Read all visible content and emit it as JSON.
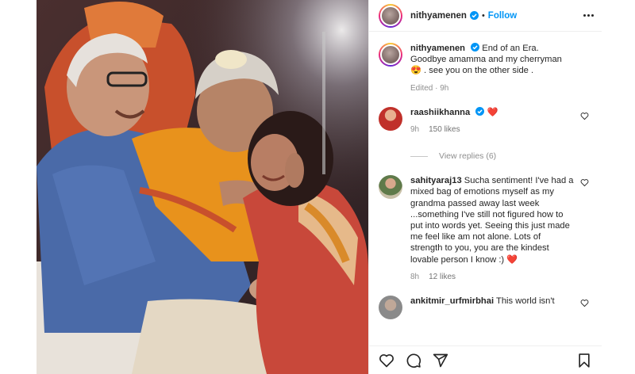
{
  "post": {
    "username": "nithyamenen",
    "follow_label": "Follow",
    "separator": "•",
    "caption": {
      "username": "nithyamenen",
      "text": "End of an Era. Goodbye amamma and my cherryman",
      "emoji": "😍",
      "text_after": " . see you on the other side .",
      "meta": "Edited · 9h"
    }
  },
  "comments": [
    {
      "username": "raashiikhanna",
      "text": "",
      "emoji": "❤️",
      "time": "9h",
      "likes": "150 likes",
      "view_replies": "View replies (6)"
    },
    {
      "username": "sahityaraj13",
      "text": "Sucha sentiment! I've had a mixed bag of emotions myself as my grandma passed away last week ...something I've still not figured how to put into words yet. Seeing this just made me feel like am not alone. Lots of strength to you, you are the kindest lovable person I know :)",
      "emoji": "❤️",
      "time": "8h",
      "likes": "12 likes"
    },
    {
      "username": "ankitmir_urfmirbhai",
      "text": "This world isn't"
    }
  ],
  "icons": {
    "verified": "verified-badge-icon",
    "more": "more-options-icon",
    "like": "heart-icon",
    "comment": "comment-icon",
    "share": "share-icon",
    "save": "bookmark-icon"
  },
  "colors": {
    "accent": "#0095f6",
    "heart": "#ff3040",
    "muted": "#8e8e8e"
  }
}
